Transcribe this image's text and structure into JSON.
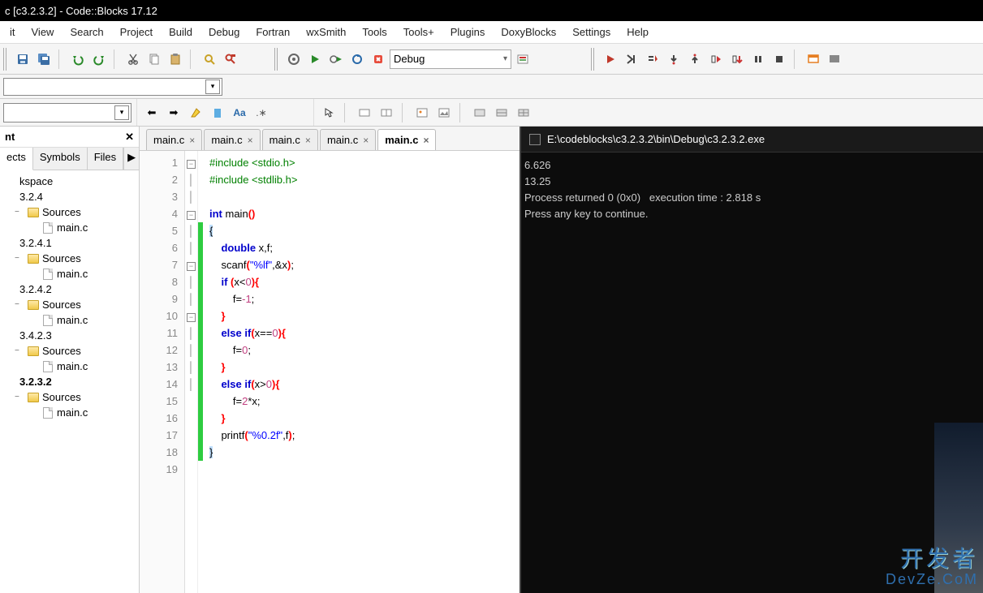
{
  "titlebar": {
    "text": "c [c3.2.3.2] - Code::Blocks 17.12"
  },
  "menus": [
    "it",
    "View",
    "Search",
    "Project",
    "Build",
    "Debug",
    "Fortran",
    "wxSmith",
    "Tools",
    "Tools+",
    "Plugins",
    "DoxyBlocks",
    "Settings",
    "Help"
  ],
  "build_target": {
    "label": "Debug"
  },
  "sidebar": {
    "title": "nt",
    "tabs": [
      "ects",
      "Symbols",
      "Files"
    ],
    "active_tab": 0,
    "tree": [
      {
        "label": "kspace",
        "type": "root",
        "indent": 0
      },
      {
        "label": "3.2.4",
        "type": "proj",
        "indent": 0
      },
      {
        "label": "Sources",
        "type": "folder",
        "indent": 1,
        "expand": "−"
      },
      {
        "label": "main.c",
        "type": "file",
        "indent": 2
      },
      {
        "label": "3.2.4.1",
        "type": "proj",
        "indent": 0
      },
      {
        "label": "Sources",
        "type": "folder",
        "indent": 1,
        "expand": "−"
      },
      {
        "label": "main.c",
        "type": "file",
        "indent": 2
      },
      {
        "label": "3.2.4.2",
        "type": "proj",
        "indent": 0
      },
      {
        "label": "Sources",
        "type": "folder",
        "indent": 1,
        "expand": "−"
      },
      {
        "label": "main.c",
        "type": "file",
        "indent": 2
      },
      {
        "label": "3.4.2.3",
        "type": "proj",
        "indent": 0
      },
      {
        "label": "Sources",
        "type": "folder",
        "indent": 1,
        "expand": "−"
      },
      {
        "label": "main.c",
        "type": "file",
        "indent": 2
      },
      {
        "label": "3.2.3.2",
        "type": "proj",
        "indent": 0,
        "bold": true
      },
      {
        "label": "Sources",
        "type": "folder",
        "indent": 1,
        "expand": "−"
      },
      {
        "label": "main.c",
        "type": "file",
        "indent": 2
      }
    ]
  },
  "editor_tabs": [
    {
      "label": "main.c",
      "active": false
    },
    {
      "label": "main.c",
      "active": false
    },
    {
      "label": "main.c",
      "active": false
    },
    {
      "label": "main.c",
      "active": false
    },
    {
      "label": "main.c",
      "active": true
    }
  ],
  "code": {
    "lines": [
      1,
      2,
      3,
      4,
      5,
      6,
      7,
      8,
      9,
      10,
      11,
      12,
      13,
      14,
      15,
      16,
      17,
      18,
      19
    ],
    "change_start": 5,
    "change_end": 18,
    "fold_at": {
      "5": "−",
      "8": "−",
      "11": "−",
      "14": "−"
    },
    "tokens": {
      "1": [
        [
          "pp",
          "#include "
        ],
        [
          "inc",
          "<stdio.h>"
        ]
      ],
      "2": [
        [
          "pp",
          "#include "
        ],
        [
          "inc",
          "<stdlib.h>"
        ]
      ],
      "3": [],
      "4": [
        [
          "kw",
          "int "
        ],
        [
          "",
          "main"
        ],
        [
          "br",
          "()"
        ]
      ],
      "5": [
        [
          "hl",
          "{"
        ]
      ],
      "6": [
        [
          "",
          "    "
        ],
        [
          "kw",
          "double "
        ],
        [
          "",
          "x,f;"
        ]
      ],
      "7": [
        [
          "",
          "    "
        ],
        [
          "",
          "scanf"
        ],
        [
          "br",
          "("
        ],
        [
          "str",
          "\"%lf\""
        ],
        [
          "",
          ",&x"
        ],
        [
          "br",
          ")"
        ],
        [
          "",
          ";"
        ]
      ],
      "8": [
        [
          "",
          "    "
        ],
        [
          "kw",
          "if "
        ],
        [
          "br",
          "("
        ],
        [
          "",
          "x<"
        ],
        [
          "num",
          "0"
        ],
        [
          "br",
          ")"
        ],
        [
          "br",
          "{"
        ]
      ],
      "9": [
        [
          "",
          "        f="
        ],
        [
          "num",
          "-1"
        ],
        [
          "",
          ";"
        ]
      ],
      "10": [
        [
          "",
          "    "
        ],
        [
          "br",
          "}"
        ]
      ],
      "11": [
        [
          "",
          "    "
        ],
        [
          "kw",
          "else if"
        ],
        [
          "br",
          "("
        ],
        [
          "",
          "x=="
        ],
        [
          "num",
          "0"
        ],
        [
          "br",
          ")"
        ],
        [
          "br",
          "{"
        ]
      ],
      "12": [
        [
          "",
          "        f="
        ],
        [
          "num",
          "0"
        ],
        [
          "",
          ";"
        ]
      ],
      "13": [
        [
          "",
          "    "
        ],
        [
          "br",
          "}"
        ]
      ],
      "14": [
        [
          "",
          "    "
        ],
        [
          "kw",
          "else if"
        ],
        [
          "br",
          "("
        ],
        [
          "",
          "x>"
        ],
        [
          "num",
          "0"
        ],
        [
          "br",
          ")"
        ],
        [
          "br",
          "{"
        ]
      ],
      "15": [
        [
          "",
          "        f="
        ],
        [
          "num",
          "2"
        ],
        [
          "",
          "*x;"
        ]
      ],
      "16": [
        [
          "",
          "    "
        ],
        [
          "br",
          "}"
        ]
      ],
      "17": [
        [
          "",
          "    printf"
        ],
        [
          "br",
          "("
        ],
        [
          "str",
          "\"%0.2f\""
        ],
        [
          "",
          ",f"
        ],
        [
          "br",
          ")"
        ],
        [
          "",
          ";"
        ]
      ],
      "18": [
        [
          "hl",
          "}"
        ]
      ],
      "19": []
    }
  },
  "console": {
    "title": "E:\\codeblocks\\c3.2.3.2\\bin\\Debug\\c3.2.3.2.exe",
    "lines": [
      "6.626",
      "13.25",
      "Process returned 0 (0x0)   execution time : 2.818 s",
      "Press any key to continue."
    ]
  },
  "watermark": {
    "line1": "开发者",
    "line2": "DevZe.CoM"
  }
}
